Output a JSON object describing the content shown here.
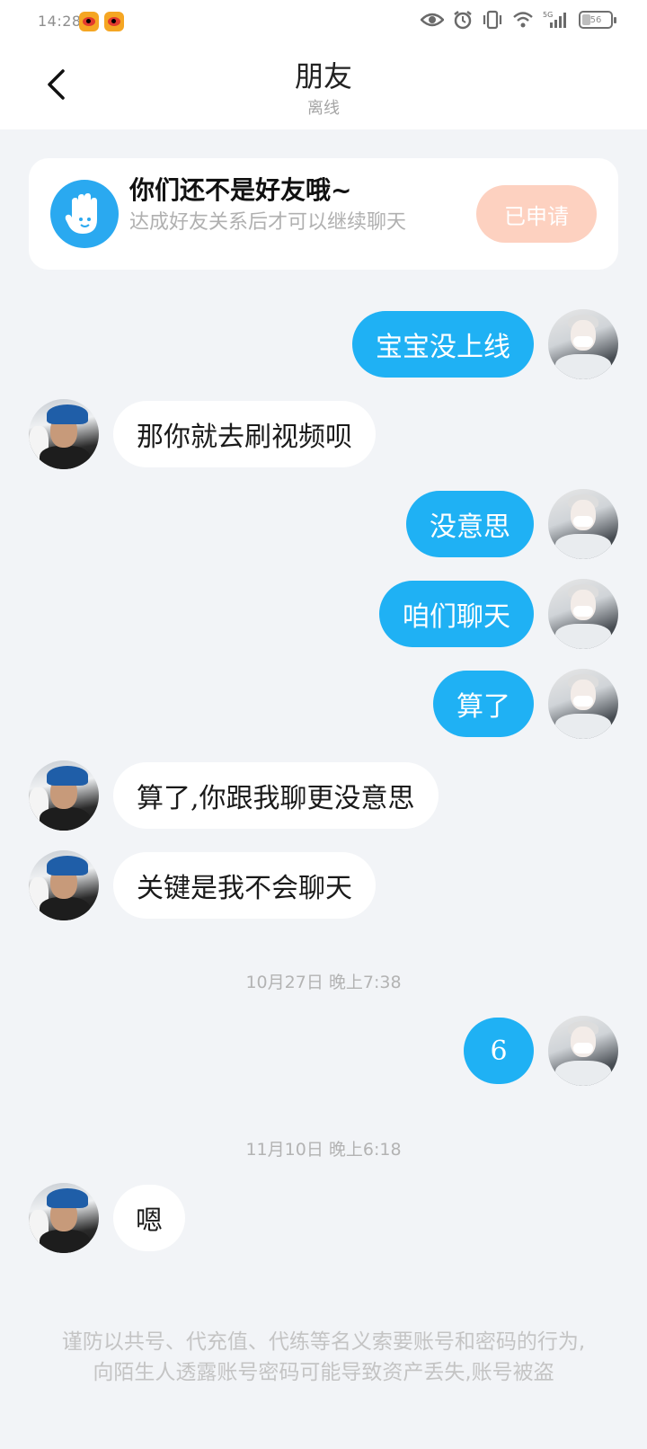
{
  "status_bar": {
    "time": "14:28",
    "battery": "56"
  },
  "header": {
    "title": "朋友",
    "subtitle": "离线"
  },
  "friend_card": {
    "title": "你们还不是好友哦~",
    "description": "达成好友关系后才可以继续聊天",
    "button": "已申请"
  },
  "messages": [
    {
      "from": "me",
      "text": "宝宝没上线"
    },
    {
      "from": "other",
      "text": "那你就去刷视频呗"
    },
    {
      "from": "me",
      "text": "没意思"
    },
    {
      "from": "me",
      "text": "咱们聊天"
    },
    {
      "from": "me",
      "text": "算了"
    },
    {
      "from": "other",
      "text": "算了,你跟我聊更没意思"
    },
    {
      "from": "other",
      "text": "关键是我不会聊天"
    },
    {
      "timestamp": "10月27日 晚上7:38"
    },
    {
      "from": "me",
      "text": "6"
    },
    {
      "timestamp": "11月10日 晚上6:18"
    },
    {
      "from": "other",
      "text": "嗯"
    }
  ],
  "warning": "谨防以共号、代充值、代练等名义索要账号和密码的行为,向陌生人透露账号密码可能导致资产丢失,账号被盗",
  "colors": {
    "bubble_mine": "#1fb1f4",
    "bubble_other": "#ffffff",
    "applied_button": "#fdd1c0",
    "background": "#f2f4f7"
  },
  "icons": [
    "back-arrow-icon",
    "hand-wave-icon",
    "eye-icon",
    "alarm-icon",
    "vibrate-icon",
    "wifi-icon",
    "signal-icon",
    "battery-icon",
    "weibo-icon"
  ]
}
